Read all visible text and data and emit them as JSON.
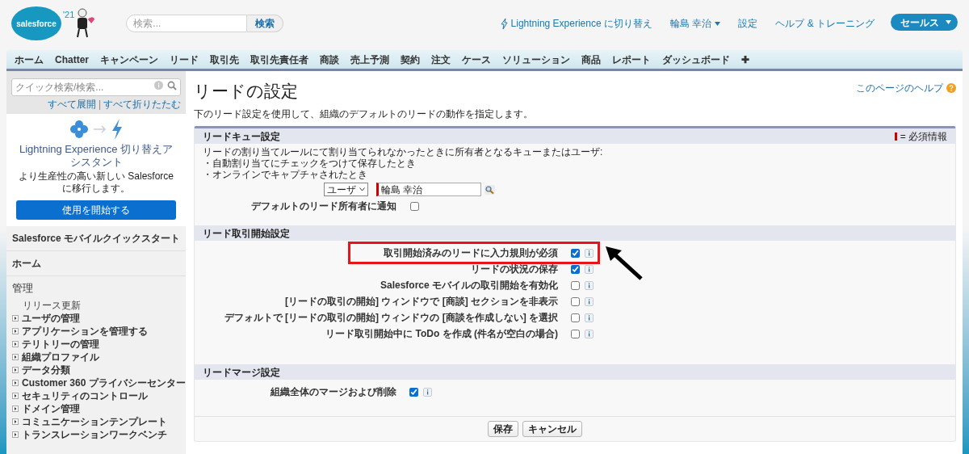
{
  "header": {
    "logo": "salesforce",
    "release_badge": "'21",
    "search": {
      "placeholder": "検索...",
      "button": "検索"
    },
    "links": [
      {
        "kind": "lightning",
        "label": "Lightning Experience に切り替え"
      },
      {
        "kind": "user",
        "label": "輪島 幸治"
      },
      {
        "kind": "plain",
        "label": "設定"
      },
      {
        "kind": "plain",
        "label": "ヘルプ & トレーニング"
      }
    ],
    "app_menu": "セールス"
  },
  "tabs": [
    "ホーム",
    "Chatter",
    "キャンペーン",
    "リード",
    "取引先",
    "取引先責任者",
    "商談",
    "売上予測",
    "契約",
    "注文",
    "ケース",
    "ソリューション",
    "商品",
    "レポート",
    "ダッシュボード",
    "✚"
  ],
  "sidebar": {
    "search": {
      "placeholder": "クイック検索/検索..."
    },
    "expand_all": "すべて展開",
    "separator": "|",
    "collapse_all": "すべて折りたたむ",
    "promo": {
      "title": "Lightning Experience 切り替えアシスタント",
      "text": "より生産性の高い新しい Salesforce に移行します。",
      "button": "使用を開始する"
    },
    "sections": [
      "Salesforce モバイルクイックスタート",
      "ホーム"
    ],
    "admin": {
      "title": "管理",
      "items": [
        {
          "kind": "link",
          "label": "リリース更新"
        },
        {
          "kind": "expandable",
          "label": "ユーザの管理"
        },
        {
          "kind": "expandable",
          "label": "アプリケーションを管理する"
        },
        {
          "kind": "expandable",
          "label": "テリトリーの管理"
        },
        {
          "kind": "expandable",
          "label": "組織プロファイル"
        },
        {
          "kind": "expandable",
          "label": "データ分類"
        },
        {
          "kind": "expandable",
          "label": "Customer 360 プライバシーセンター"
        },
        {
          "kind": "expandable",
          "label": "セキュリティのコントロール"
        },
        {
          "kind": "expandable",
          "label": "ドメイン管理"
        },
        {
          "kind": "expandable",
          "label": "コミュニケーションテンプレート"
        },
        {
          "kind": "expandable",
          "label": "トランスレーションワークベンチ"
        }
      ]
    }
  },
  "page": {
    "title": "リードの設定",
    "help_link": "このページのヘルプ",
    "description": "下のリード設定を使用して、組織のデフォルトのリードの動作を指定します。",
    "required_legend": "= 必須情報",
    "queue_section": {
      "title": "リードキュー設定",
      "lines": [
        "リードの割り当てルールにて割り当てられなかったときに所有者となるキューまたはユーザ:",
        "・自動割り当てにチェックをつけて保存したとき",
        "・オンラインでキャプチャされたとき"
      ],
      "owner_type": "ユーザ",
      "owner": "輪島 幸治",
      "notify": {
        "label": "デフォルトのリード所有者に通知",
        "checked": false
      }
    },
    "convert_section": {
      "title": "リード取引開始設定",
      "settings": [
        {
          "label": "取引開始済みのリードに入力規則が必須",
          "checked": true,
          "highlighted": true
        },
        {
          "label": "リードの状況の保存",
          "checked": true,
          "highlighted": false
        },
        {
          "label": "Salesforce モバイルの取引開始を有効化",
          "checked": false,
          "highlighted": false
        },
        {
          "label": "[リードの取引の開始] ウィンドウで [商談] セクションを非表示",
          "checked": false,
          "highlighted": false
        },
        {
          "label": "デフォルトで [リードの取引の開始] ウィンドウの [商談を作成しない] を選択",
          "checked": false,
          "highlighted": false
        },
        {
          "label": "リード取引開始中に ToDo を作成 (件名が空白の場合)",
          "checked": false,
          "highlighted": false
        }
      ]
    },
    "merge_section": {
      "title": "リードマージ設定",
      "settings": [
        {
          "label": "組織全体のマージおよび削除",
          "checked": true,
          "highlighted": false
        }
      ]
    },
    "buttons": [
      "保存",
      "キャンセル"
    ]
  }
}
